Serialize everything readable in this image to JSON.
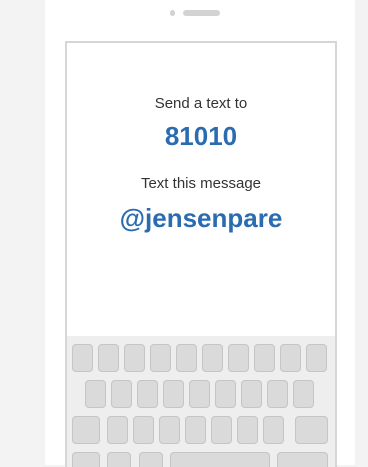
{
  "instructions": {
    "send_label": "Send a text to",
    "number": "81010",
    "text_label": "Text this message",
    "handle": "@jensenpare"
  },
  "colors": {
    "accent": "#2b6cb0",
    "text": "#333333",
    "keyboard_bg": "#eeeeee",
    "key": "#dadada"
  }
}
